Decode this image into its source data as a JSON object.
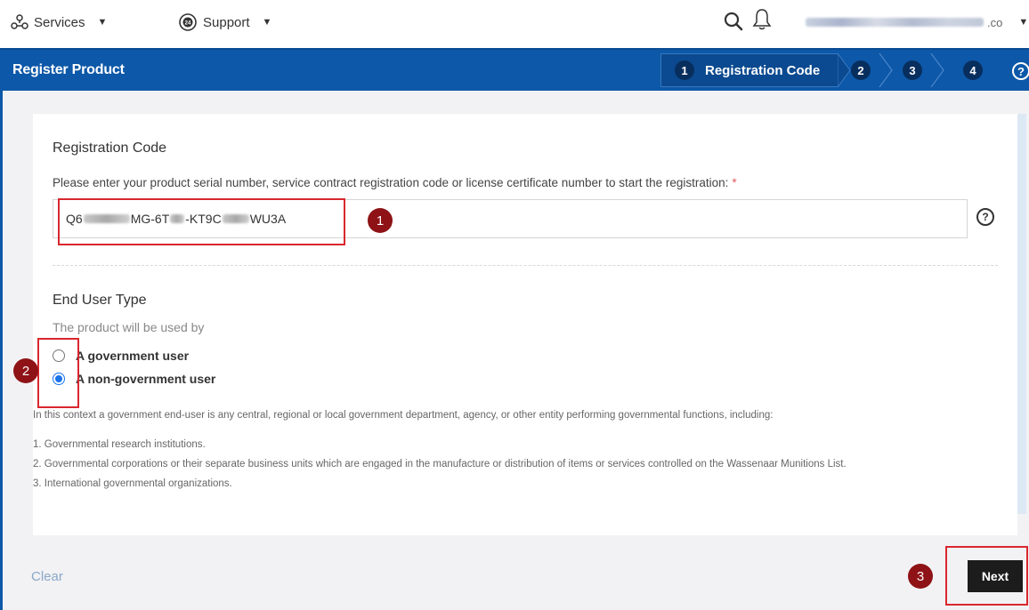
{
  "topnav": {
    "services_label": "Services",
    "support_label": "Support",
    "user_email_suffix": ".co"
  },
  "header": {
    "title": "Register Product",
    "steps": [
      {
        "number": "1",
        "label": "Registration Code",
        "active": true
      },
      {
        "number": "2",
        "label": ""
      },
      {
        "number": "3",
        "label": ""
      },
      {
        "number": "4",
        "label": ""
      }
    ]
  },
  "form": {
    "section1_title": "Registration Code",
    "instruction": "Please enter your product serial number, service contract registration code or license certificate number to start the registration:",
    "required_mark": "*",
    "code_parts": [
      "Q6",
      "MG-6T",
      "-KT9C",
      "WU3A"
    ],
    "section2_title": "End User Type",
    "used_by": "The product will be used by",
    "options": [
      {
        "label": "A government user",
        "checked": false
      },
      {
        "label": "A non-government user",
        "checked": true
      }
    ],
    "note": "In this context a government end-user is any central, regional or local government department, agency, or other entity performing governmental functions, including:",
    "list": [
      "1. Governmental research institutions.",
      "2. Governmental corporations or their separate business units which are engaged in the manufacture or distribution of items or services controlled on the Wassenaar Munitions List.",
      "3. International governmental organizations."
    ]
  },
  "footer": {
    "clear_label": "Clear",
    "next_label": "Next"
  },
  "annotations": [
    "1",
    "2",
    "3"
  ],
  "colors": {
    "header_blue": "#0d58a8",
    "step_dark": "#082e5e",
    "highlight_red": "#d9272e",
    "badge_red": "#8e1216",
    "radio_blue": "#1a73e8"
  }
}
